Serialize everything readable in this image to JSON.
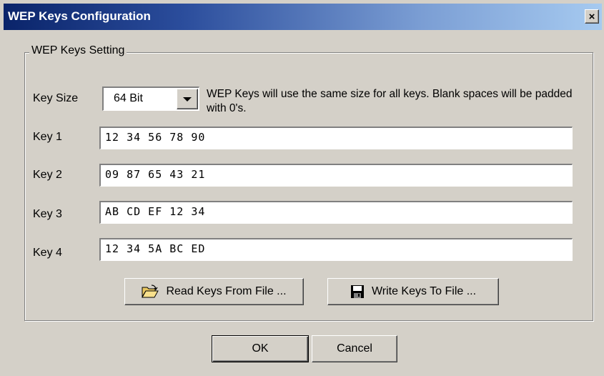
{
  "window": {
    "title": "WEP Keys Configuration",
    "close_label": "×"
  },
  "group": {
    "title": "WEP Keys Setting",
    "key_size_label": "Key Size",
    "key_size_value": "64 Bit",
    "note": "WEP Keys will use the same size for all keys. Blank spaces will be padded with 0's.",
    "keys": [
      {
        "label": "Key 1",
        "value": "12 34 56 78 90"
      },
      {
        "label": "Key 2",
        "value": "09 87 65 43 21"
      },
      {
        "label": "Key 3",
        "value": "AB CD EF 12 34"
      },
      {
        "label": "Key 4",
        "value": "12 34 5A BC ED"
      }
    ],
    "read_button": "Read Keys From File ...",
    "write_button": "Write Keys To File ..."
  },
  "footer": {
    "ok": "OK",
    "cancel": "Cancel"
  },
  "icons": {
    "read": "open-folder-icon",
    "write": "floppy-disk-icon",
    "close": "close-icon",
    "dropdown": "chevron-down-icon"
  }
}
